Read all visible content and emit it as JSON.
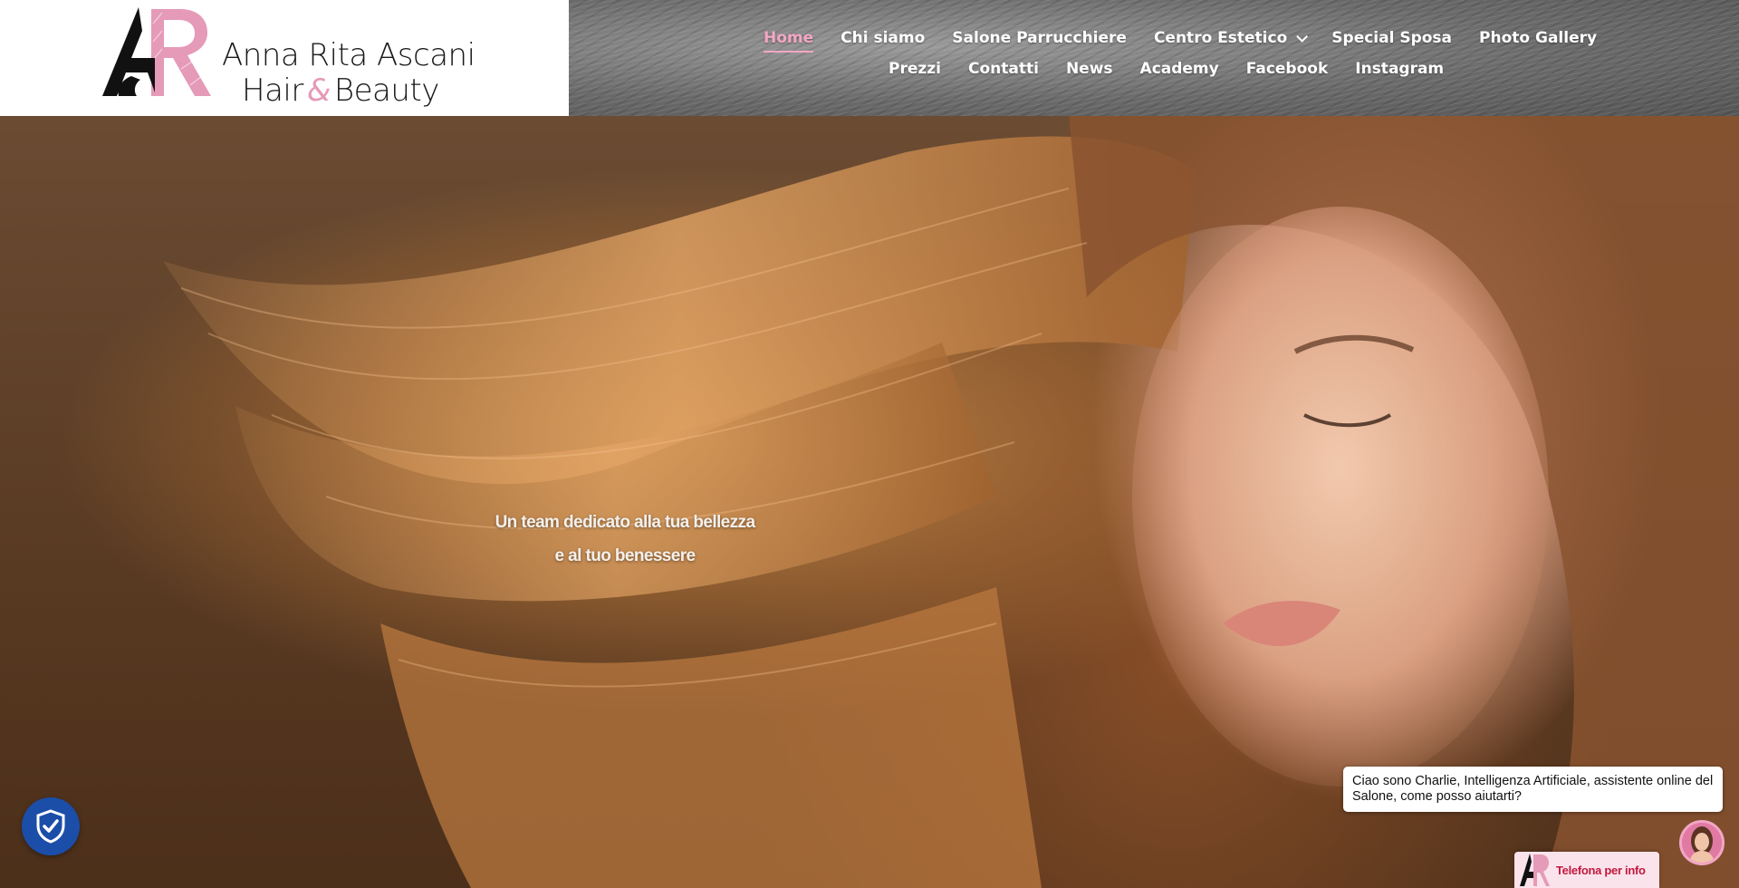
{
  "header": {
    "logo": {
      "line1": "Anna Rita Ascani",
      "line2_left": "Hair",
      "line2_amp": "&",
      "line2_right": "Beauty",
      "monogram": "AR",
      "accent_color": "#e59ab8"
    },
    "nav": {
      "row1": [
        {
          "label": "Home",
          "active": true
        },
        {
          "label": "Chi siamo",
          "active": false
        },
        {
          "label": "Salone Parrucchiere",
          "active": false
        },
        {
          "label": "Centro Estetico",
          "active": false,
          "has_dropdown": true
        },
        {
          "label": "Special Sposa",
          "active": false
        },
        {
          "label": "Photo Gallery",
          "active": false
        }
      ],
      "row2": [
        {
          "label": "Prezzi"
        },
        {
          "label": "Contatti"
        },
        {
          "label": "News"
        },
        {
          "label": "Academy"
        },
        {
          "label": "Facebook"
        },
        {
          "label": "Instagram"
        }
      ],
      "active_color": "#f3a6c4"
    }
  },
  "hero": {
    "tagline_line1": "Un team dedicato alla tua bellezza",
    "tagline_line2": "e al tuo benessere"
  },
  "widgets": {
    "privacy_icon": "shield-check-icon",
    "privacy_color": "#1b4ea8",
    "chat_message": "Ciao sono Charlie, Intelligenza Artificiale, assistente online del Salone, come posso aiutarti?",
    "chat_avatar_icon": "assistant-avatar-icon",
    "call_button_label": "Telefona per info",
    "call_color": "#c0193f"
  }
}
